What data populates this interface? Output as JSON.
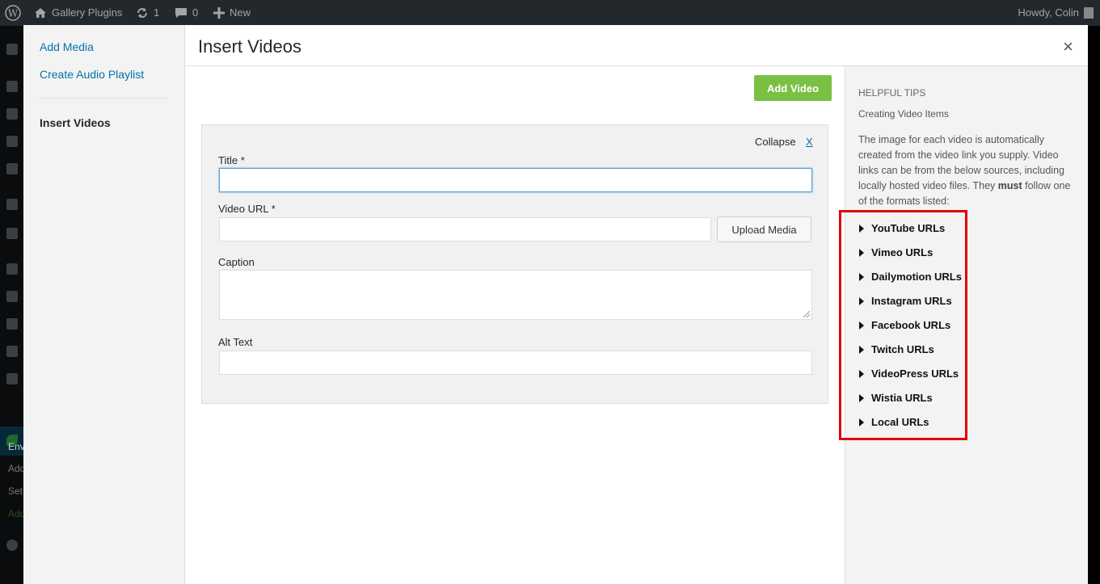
{
  "adminbar": {
    "site_name": "Gallery Plugins",
    "updates_count": "1",
    "comments_count": "0",
    "new_label": "New",
    "howdy": "Howdy, Colin"
  },
  "wp_menu_fragments": [
    "Env",
    "Add",
    "Set",
    "Add"
  ],
  "modal_menu": {
    "items": [
      "Add Media",
      "Create Audio Playlist"
    ],
    "active": "Insert Videos"
  },
  "modal": {
    "title": "Insert Videos",
    "close_glyph": "×",
    "add_video_label": "Add Video",
    "collapse_label": "Collapse",
    "remove_label": "X",
    "fields": {
      "title_label": "Title *",
      "title_value": "",
      "url_label": "Video URL *",
      "url_value": "",
      "upload_label": "Upload Media",
      "caption_label": "Caption",
      "caption_value": "",
      "alt_label": "Alt Text",
      "alt_value": ""
    }
  },
  "tips": {
    "heading": "HELPFUL TIPS",
    "subheading": "Creating Video Items",
    "text_before": "The image for each video is automatically created from the video link you supply. Video links can be from the below sources, including locally hosted video files. They ",
    "text_bold": "must",
    "text_after": " follow one of the formats listed:",
    "url_types": [
      "YouTube URLs",
      "Vimeo URLs",
      "Dailymotion URLs",
      "Instagram URLs",
      "Facebook URLs",
      "Twitch URLs",
      "VideoPress URLs",
      "Wistia URLs",
      "Local URLs"
    ],
    "highlight_color": "#e00000"
  },
  "colors": {
    "admin_bar": "#23282d",
    "accent_link": "#0073aa",
    "add_button": "#7ac143"
  }
}
